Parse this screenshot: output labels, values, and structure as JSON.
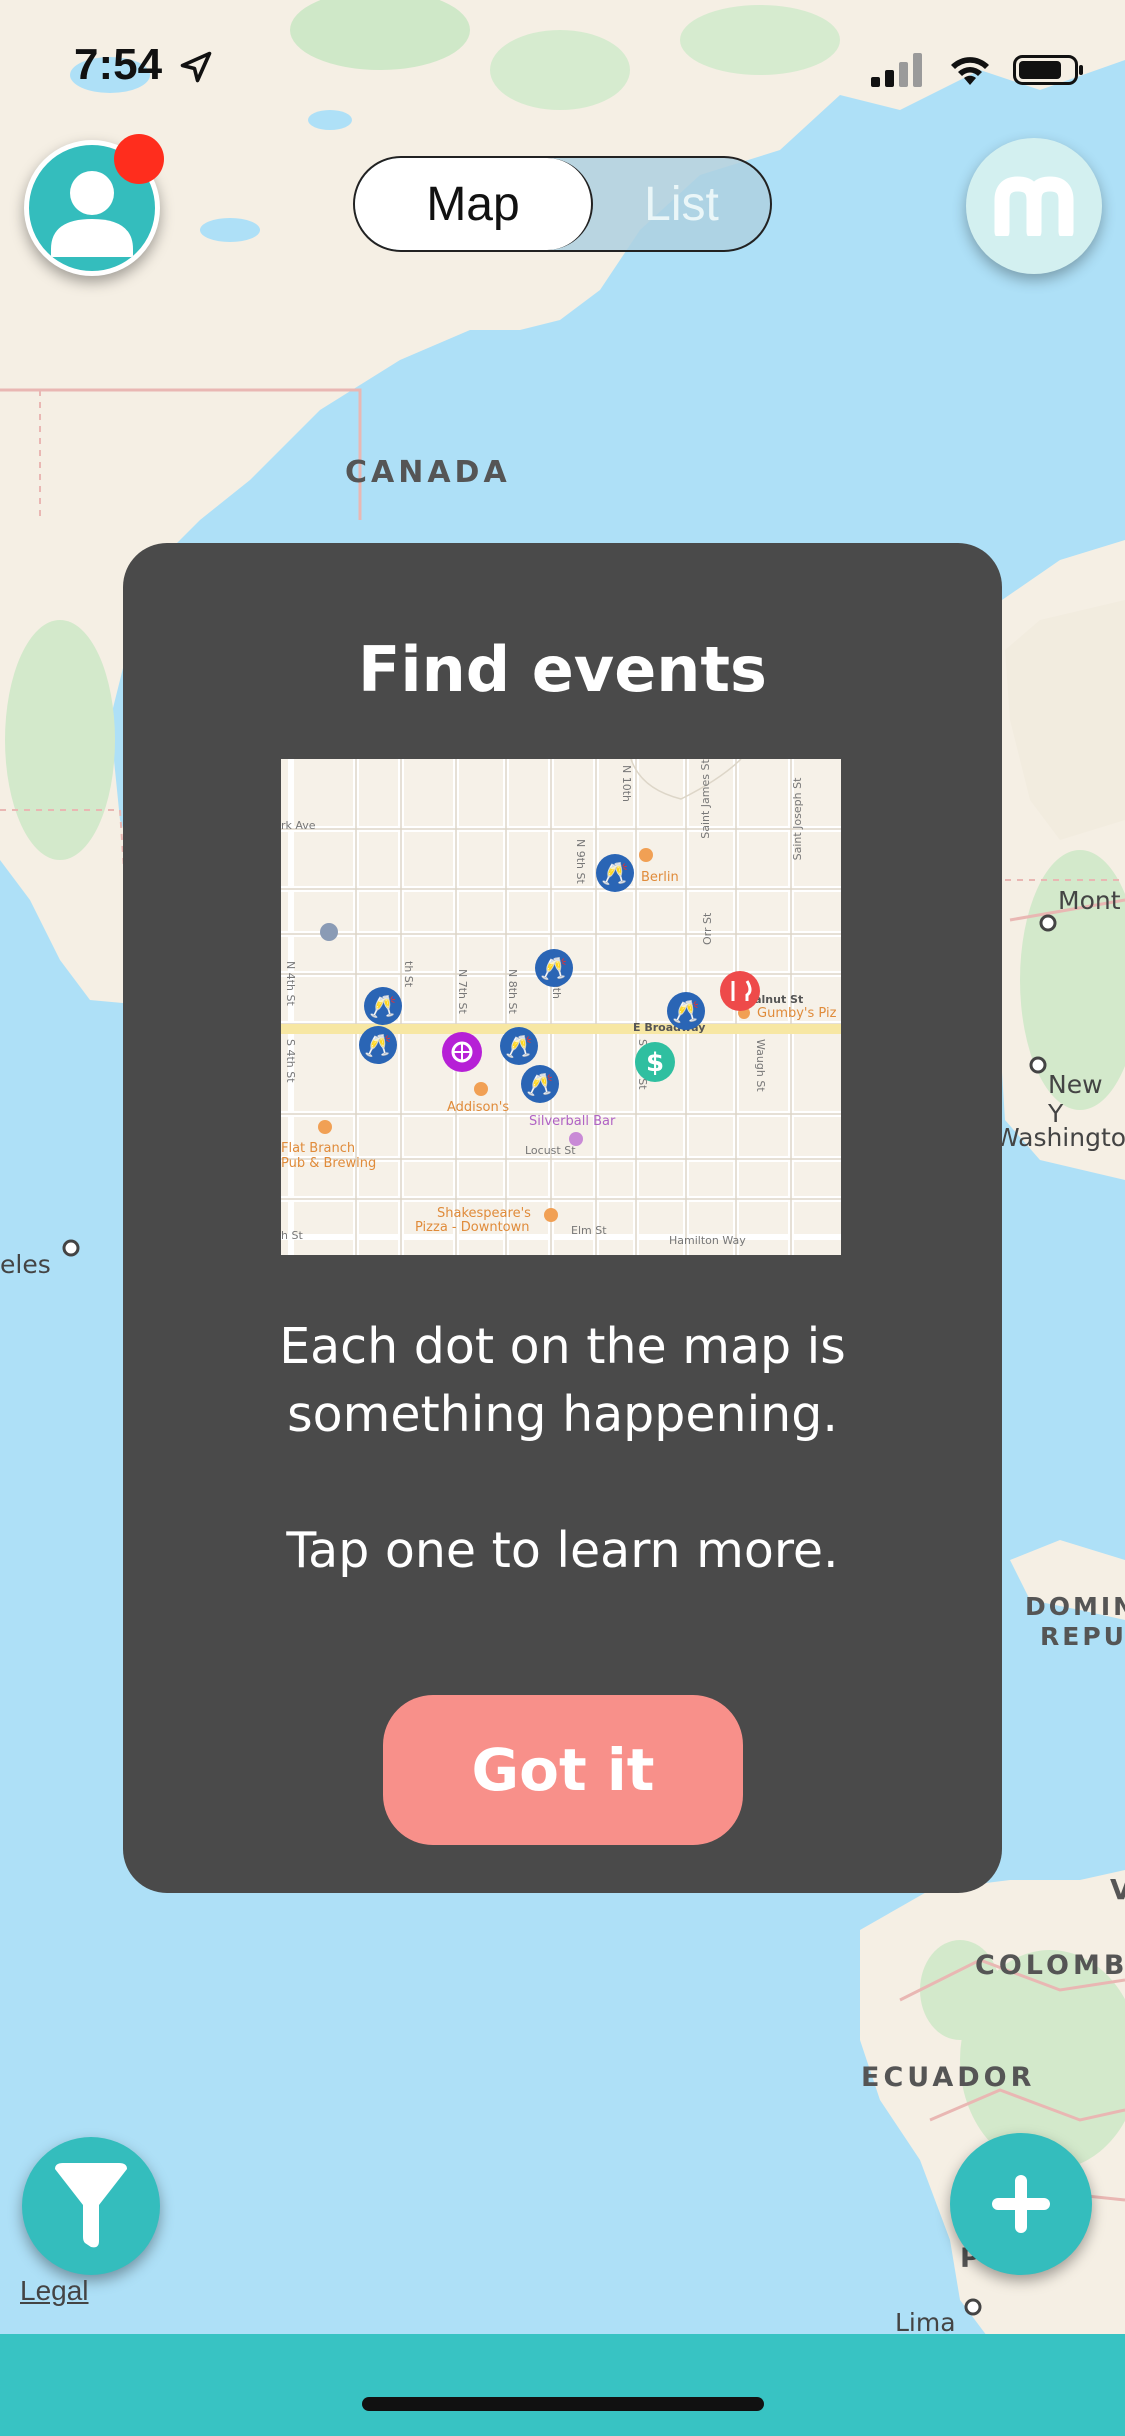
{
  "status_bar": {
    "time": "7:54"
  },
  "header": {
    "segments": [
      {
        "label": "Map",
        "selected": true
      },
      {
        "label": "List",
        "selected": false
      }
    ]
  },
  "map": {
    "labels": {
      "canada": "CANADA",
      "dominican_1": "DOMIN",
      "dominican_2": "REPU",
      "colombia": "COLOMB",
      "ecuador": "ECUADOR",
      "venezuela_fragment": "V",
      "peru_fragment": "P"
    },
    "cities": {
      "montreal": "Mont",
      "new_york": "New Y",
      "washington": "Washingto",
      "los_angeles": "eles",
      "lima": "Lima"
    },
    "legal": "Legal"
  },
  "modal": {
    "title": "Find events",
    "body_line_1": "Each dot on the map is something happening.",
    "body_line_2": "Tap one to learn more.",
    "button": "Got it",
    "preview": {
      "streets": {
        "rk_ave": "rk Ave",
        "n10th": "N 10th",
        "st_james": "Saint James St",
        "st_joseph": "Saint Joseph St",
        "n9th_top": "N 9th St",
        "orr": "Orr St",
        "walnut": "E Walnut St",
        "broadway": "E Broadway",
        "n4th": "N 4th St",
        "n7th": "th St",
        "n2th": "N 7th St",
        "n8th": "N 8th St",
        "n9th_mid": "N 9th",
        "s4th": "S 4th St",
        "s8th": "S 8",
        "s10th": "S 10th St",
        "waugh": "Waugh St",
        "locust": "Locust St",
        "elm": "Elm St",
        "hamilton": "Hamilton Way",
        "h_st": "h St"
      },
      "places": {
        "berlin": "Berlin",
        "gumbys": "Gumby's Piz",
        "addisons": "Addison's",
        "silverball": "Silverball Bar",
        "flat_branch_1": "Flat Branch",
        "flat_branch_2": "Pub & Brewing",
        "shakespeares_1": "Shakespeare's",
        "shakespeares_2": "Pizza - Downtown"
      },
      "pin_colors": {
        "drinks": "#2a65b5",
        "party": "#b620d6",
        "money": "#2fbfa0",
        "food": "#ee4a4a"
      }
    }
  },
  "colors": {
    "accent": "#34bdbd",
    "button": "#f8908a",
    "modal": "#4a4a4a",
    "notification": "#ff2d1d"
  }
}
